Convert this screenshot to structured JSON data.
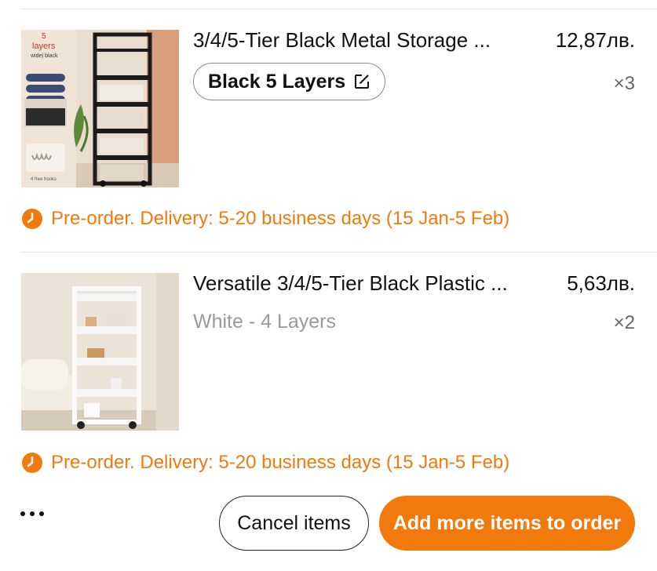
{
  "items": [
    {
      "title": "3/4/5-Tier Black Metal Storage ...",
      "price": "12,87лв.",
      "variant": "Black 5 Layers",
      "variant_editable": true,
      "quantity": "×3",
      "image_caption_top": "5",
      "image_caption_mid": "layers",
      "image_caption_sub": "wide| black",
      "image_caption_bottom": "4 free hooks",
      "notice": "Pre-order. Delivery: 5-20 business days (15 Jan-5 Feb)"
    },
    {
      "title": "Versatile 3/4/5-Tier Black Plastic ...",
      "price": "5,63лв.",
      "variant": "White - 4 Layers",
      "variant_editable": false,
      "quantity": "×2",
      "notice": "Pre-order. Delivery: 5-20 business days (15 Jan-5 Feb)"
    }
  ],
  "footer": {
    "cancel_label": "Cancel items",
    "add_label": "Add more items to order"
  },
  "colors": {
    "accent": "#f27a0d",
    "muted": "#9a9a9a"
  }
}
